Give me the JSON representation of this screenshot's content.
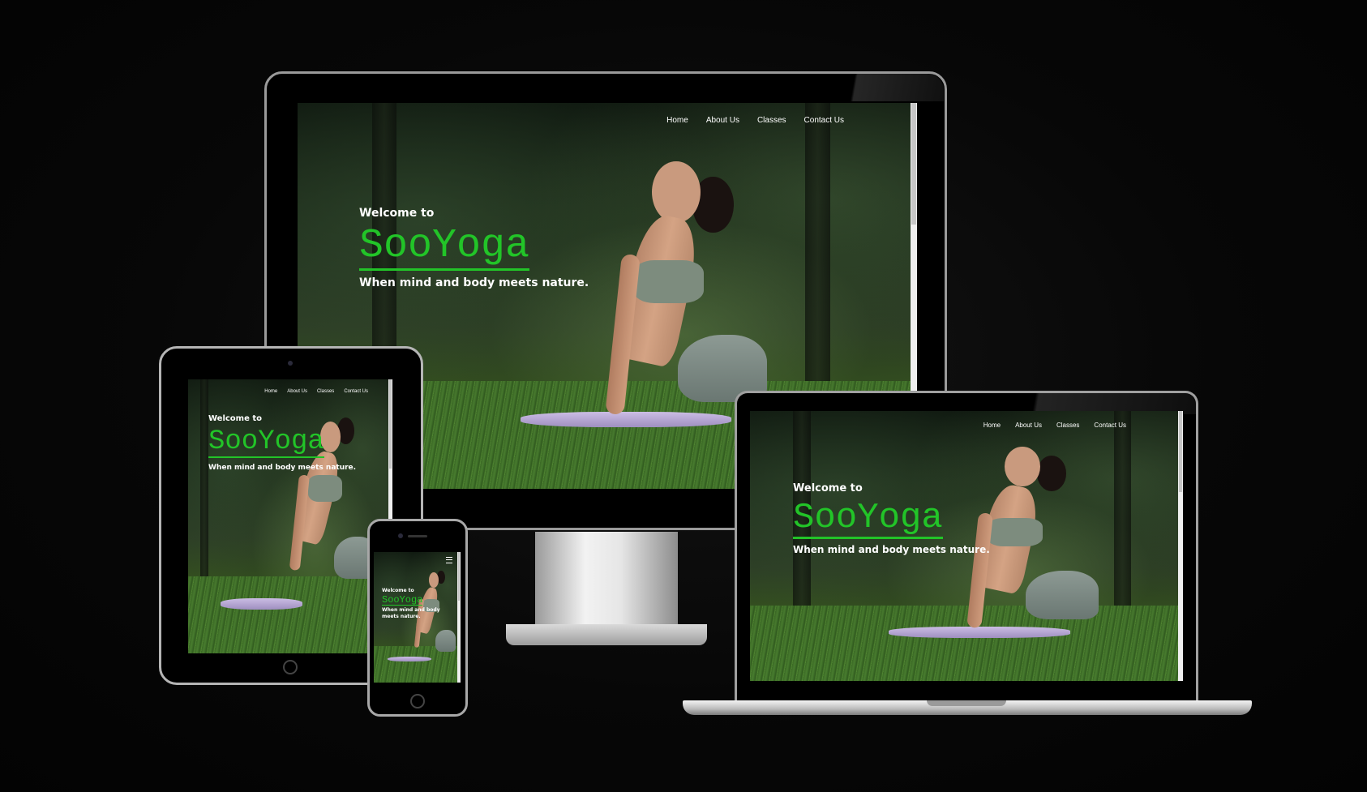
{
  "site": {
    "nav": [
      "Home",
      "About Us",
      "Classes",
      "Contact Us"
    ],
    "welcome": "Welcome to",
    "brand": "SooYoga",
    "tagline": "When mind and body meets nature.",
    "menu_icon": "hamburger-icon"
  },
  "colors": {
    "brand_green": "#22c428",
    "background": "#050505"
  }
}
